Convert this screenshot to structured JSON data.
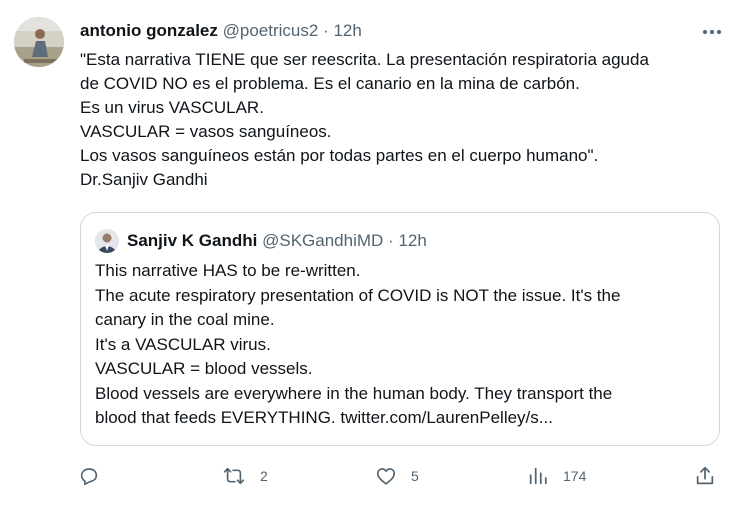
{
  "tweet": {
    "author_name": "antonio gonzalez",
    "author_handle": "@poetricus2",
    "separator": "·",
    "time": "12h",
    "lines": [
      "\"Esta narrativa TIENE que ser reescrita. La presentación respiratoria aguda",
      "de COVID NO es el problema. Es el canario en la mina de carbón.",
      "Es un virus VASCULAR.",
      "VASCULAR = vasos sanguíneos.",
      "Los vasos sanguíneos están por todas partes en el cuerpo humano\".",
      "Dr.Sanjiv Gandhi"
    ]
  },
  "quote": {
    "author_name": "Sanjiv K Gandhi",
    "author_handle": "@SKGandhiMD",
    "separator": "·",
    "time": "12h",
    "lines": [
      "This narrative HAS to be re-written.",
      "The acute respiratory presentation of COVID is NOT the issue. It's the",
      "canary in the coal mine.",
      "It's a VASCULAR virus.",
      "VASCULAR = blood vessels.",
      "Blood vessels are everywhere in the human body. They transport the",
      "blood that feeds EVERYTHING. twitter.com/LaurenPelley/s..."
    ]
  },
  "actions": {
    "reply_count": "",
    "retweet_count": "2",
    "like_count": "5",
    "views_count": "174"
  },
  "icons": {
    "reply": "reply-icon",
    "retweet": "retweet-icon",
    "like": "heart-icon",
    "views": "views-icon",
    "share": "share-icon",
    "more": "more-icon"
  },
  "colors": {
    "text": "#0f1419",
    "muted": "#536471",
    "border": "#cfd9de"
  }
}
